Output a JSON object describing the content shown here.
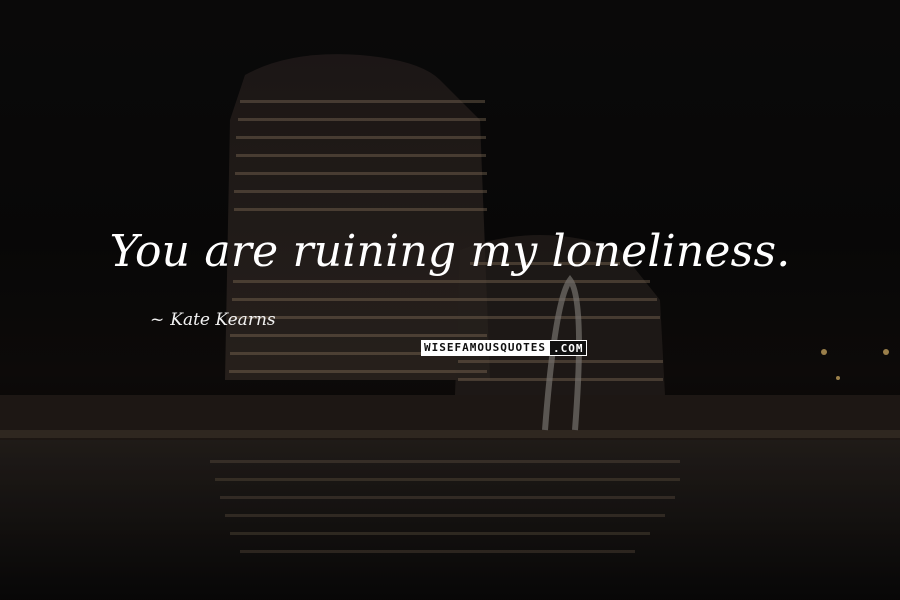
{
  "quote": {
    "text": "You are ruining my loneliness."
  },
  "author": {
    "dash": "~",
    "name": "Kate Kearns"
  },
  "watermark": {
    "left": "WISEFAMOUSQUOTES",
    "right": ".COM"
  },
  "background": {
    "description_color": "#0b0a0a",
    "text_color": "#ffffff"
  }
}
